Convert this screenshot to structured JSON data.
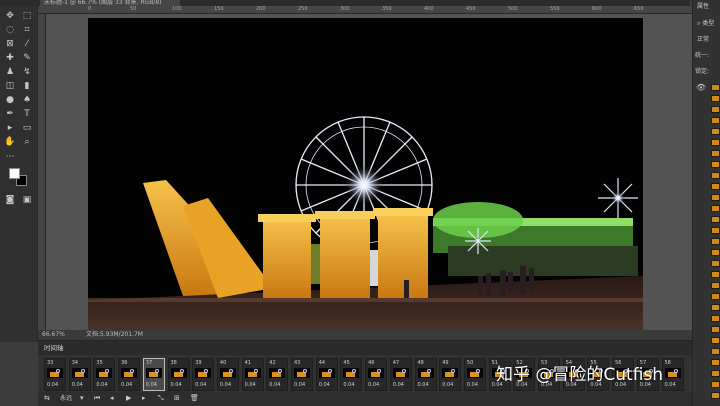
{
  "document_tab": {
    "title": "未标题-1 @ 66.7% (图层 33 背景, RGB/8)"
  },
  "ruler": {
    "top_ticks": [
      "0",
      "50",
      "100",
      "150",
      "200",
      "250",
      "300",
      "350",
      "400",
      "450",
      "500",
      "550",
      "600",
      "650"
    ]
  },
  "status": {
    "zoom": "66.67%",
    "doc_info": "文档:5.93M/201.7M"
  },
  "right_panel": {
    "header": "属性",
    "search_kind": "类型",
    "blend_mode": "正常",
    "unify_label": "统一:",
    "lock_label": "锁定:"
  },
  "timeline": {
    "title": "时间轴",
    "loop_option": "永远",
    "frames": [
      {
        "number": "33",
        "delay": "0.04"
      },
      {
        "number": "34",
        "delay": "0.04"
      },
      {
        "number": "35",
        "delay": "0.04"
      },
      {
        "number": "36",
        "delay": "0.04"
      },
      {
        "number": "37",
        "delay": "0.04",
        "selected": true
      },
      {
        "number": "38",
        "delay": "0.04"
      },
      {
        "number": "39",
        "delay": "0.04"
      },
      {
        "number": "40",
        "delay": "0.04"
      },
      {
        "number": "41",
        "delay": "0.04"
      },
      {
        "number": "42",
        "delay": "0.04"
      },
      {
        "number": "43",
        "delay": "0.04"
      },
      {
        "number": "44",
        "delay": "0.04"
      },
      {
        "number": "45",
        "delay": "0.04"
      },
      {
        "number": "46",
        "delay": "0.04"
      },
      {
        "number": "47",
        "delay": "0.04"
      },
      {
        "number": "48",
        "delay": "0.04"
      },
      {
        "number": "49",
        "delay": "0.04"
      },
      {
        "number": "50",
        "delay": "0.04"
      },
      {
        "number": "51",
        "delay": "0.04"
      },
      {
        "number": "52",
        "delay": "0.04"
      },
      {
        "number": "53",
        "delay": "0.04"
      },
      {
        "number": "54",
        "delay": "0.04"
      },
      {
        "number": "55",
        "delay": "0.04"
      },
      {
        "number": "56",
        "delay": "0.04"
      },
      {
        "number": "57",
        "delay": "0.04"
      },
      {
        "number": "58",
        "delay": "0.04"
      }
    ]
  },
  "watermark": {
    "text": "知乎 @冒险的Cutfish"
  },
  "colors": {
    "foreground": "#ffffff",
    "background": "#000000",
    "ui_dark": "#323232",
    "canvas_bg": "#535353",
    "accent_gold": "#e3a228"
  }
}
